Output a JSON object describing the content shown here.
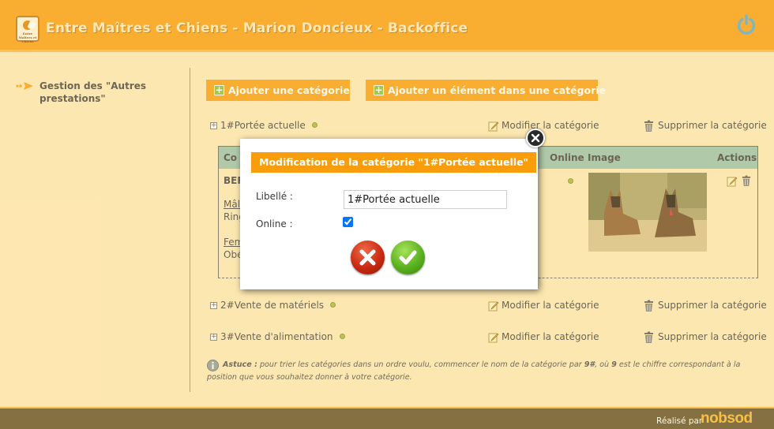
{
  "header": {
    "title": "Entre Maîtres et Chiens - Marion Doncieux - Backoffice",
    "logo_text": "Entre Maîtres et Chiens"
  },
  "sidebar": {
    "items": [
      {
        "label": "Gestion des \"Autres prestations\""
      }
    ]
  },
  "toolbar": {
    "add_category": "Ajouter une catégorie",
    "add_element": "Ajouter un élément dans une catégorie"
  },
  "categories": [
    {
      "name": "1#Portée actuelle",
      "edit_label": "Modifier la catégorie",
      "delete_label": "Supprimer la catégorie"
    },
    {
      "name": "2#Vente de matériels",
      "edit_label": "Modifier la catégorie",
      "delete_label": "Supprimer la catégorie"
    },
    {
      "name": "3#Vente d'alimentation",
      "edit_label": "Modifier la catégorie",
      "delete_label": "Supprimer la catégorie"
    }
  ],
  "table": {
    "headers": [
      "Co",
      "Online",
      "Image",
      "Actions"
    ],
    "row": {
      "title": "BER",
      "male_label": "Mâle",
      "male_text": "Ring",
      "female_label": "Fem",
      "female_text": "Obé"
    }
  },
  "tip": {
    "prefix": "Astuce :",
    "text_1": " pour trier les catégories dans un ordre voulu, commencer le nom de la catégorie par ",
    "code_1": "9#",
    "text_2": ", où ",
    "code_2": "9",
    "text_3": " est le chiffre correspondant à la position que vous souhaitez donner à votre catégorie."
  },
  "modal": {
    "title": "Modification de la catégorie \"1#Portée actuelle\"",
    "label_field": "Libellé :",
    "label_value": "1#Portée actuelle",
    "online_field": "Online :",
    "online_checked": true
  },
  "footer": {
    "label": "Réalisé par",
    "brand": "nobsod"
  },
  "colors": {
    "accent": "#f99d0c",
    "background": "#fde9b6",
    "table_header": "#96c2ad",
    "footer": "#5d4a22"
  }
}
